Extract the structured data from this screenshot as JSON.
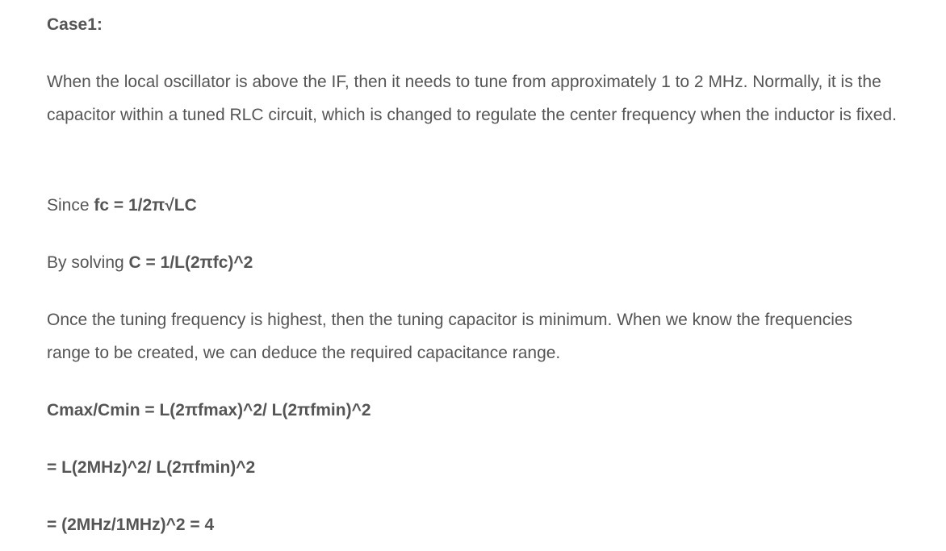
{
  "heading": "Case1:",
  "paragraph1": "When the local oscillator is above the IF, then it needs to tune from approximately 1 to 2 MHz. Normally, it is the capacitor within a tuned RLC circuit, which is changed to regulate the center frequency when the inductor is fixed.",
  "since": {
    "prefix": "Since ",
    "formula": "fc = 1/2π√LC"
  },
  "solving": {
    "prefix": "By solving ",
    "formula": "C = 1/L(2πfc)^2"
  },
  "paragraph2": "Once the tuning frequency is highest, then the tuning capacitor is minimum. When we know the frequencies range to be created, we can deduce the required capacitance range.",
  "equations": [
    "Cmax/Cmin = L(2πfmax)^2/ L(2πfmin)^2",
    "= L(2MHz)^2/ L(2πfmin)^2",
    "= (2MHz/1MHz)^2 = 4"
  ]
}
